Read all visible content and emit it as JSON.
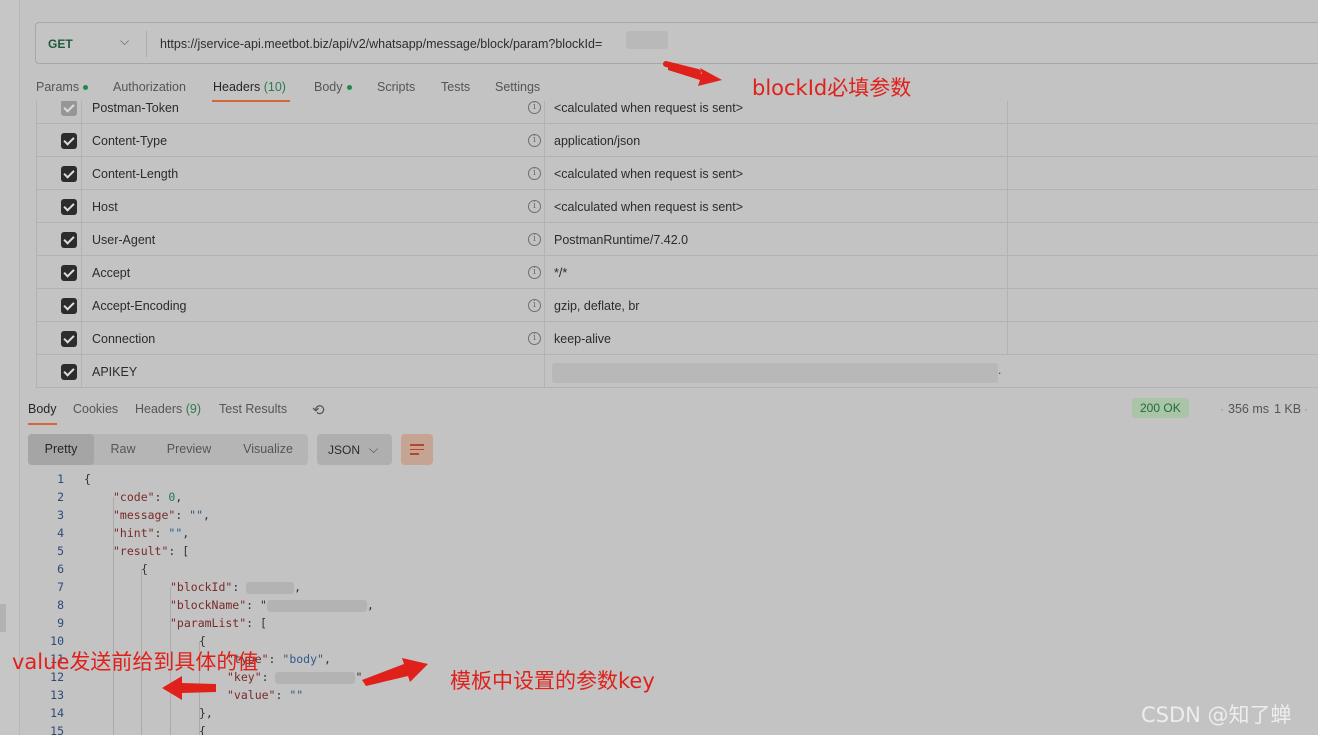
{
  "request": {
    "method": "GET",
    "url": "https://jservice-api.meetbot.biz/api/v2/whatsapp/message/block/param?blockId="
  },
  "request_tabs": [
    {
      "label": "Params",
      "dot": true
    },
    {
      "label": "Authorization"
    },
    {
      "label": "Headers",
      "count": "(10)",
      "active": true
    },
    {
      "label": "Body",
      "dot": true
    },
    {
      "label": "Scripts"
    },
    {
      "label": "Tests"
    },
    {
      "label": "Settings"
    }
  ],
  "headers": [
    {
      "key": "Postman-Token",
      "value": "<calculated when request is sent>",
      "dim": true
    },
    {
      "key": "Content-Type",
      "value": "application/json"
    },
    {
      "key": "Content-Length",
      "value": "<calculated when request is sent>"
    },
    {
      "key": "Host",
      "value": "<calculated when request is sent>"
    },
    {
      "key": "User-Agent",
      "value": "PostmanRuntime/7.42.0"
    },
    {
      "key": "Accept",
      "value": "*/*"
    },
    {
      "key": "Accept-Encoding",
      "value": "gzip, deflate, br"
    },
    {
      "key": "Connection",
      "value": "keep-alive"
    },
    {
      "key": "APIKEY",
      "value": ".",
      "blurred": true
    }
  ],
  "response_tabs": [
    {
      "label": "Body",
      "active": true
    },
    {
      "label": "Cookies"
    },
    {
      "label": "Headers",
      "count": "(9)"
    },
    {
      "label": "Test Results"
    }
  ],
  "response_meta": {
    "status": "200 OK",
    "time": "356 ms",
    "size": "1 KB",
    "separator": "·"
  },
  "view_modes": [
    "Pretty",
    "Raw",
    "Preview",
    "Visualize"
  ],
  "format": "JSON",
  "code_lines": [
    {
      "n": "1",
      "text": "{"
    },
    {
      "n": "2",
      "key": "\"code\"",
      "sep": ": ",
      "num": "0",
      "end": ","
    },
    {
      "n": "3",
      "key": "\"message\"",
      "sep": ": ",
      "str": "\"\"",
      "end": ","
    },
    {
      "n": "4",
      "key": "\"hint\"",
      "sep": ": ",
      "str": "\"\"",
      "end": ","
    },
    {
      "n": "5",
      "key": "\"result\"",
      "sep": ": ",
      "end": "["
    },
    {
      "n": "6",
      "text": "{"
    },
    {
      "n": "7",
      "key": "\"blockId\"",
      "sep": ": ",
      "blur": true,
      "end": ","
    },
    {
      "n": "8",
      "key": "\"blockName\"",
      "sep": ": \"",
      "blur": true,
      "end": ","
    },
    {
      "n": "9",
      "key": "\"paramList\"",
      "sep": ": ",
      "end": "["
    },
    {
      "n": "10",
      "text": "{"
    },
    {
      "n": "11",
      "key": "\"type\"",
      "sep": ": ",
      "str": "\"body\"",
      "end": ","
    },
    {
      "n": "12",
      "key": "\"key\"",
      "sep": ": ",
      "blur": true,
      "end": "\","
    },
    {
      "n": "13",
      "key": "\"value\"",
      "sep": ": ",
      "str": "\"\""
    },
    {
      "n": "14",
      "text": "},"
    },
    {
      "n": "15",
      "text": "{"
    }
  ],
  "annotations": {
    "block_id": "blockId必填参数",
    "param_key": "模板中设置的参数key",
    "value_note": "value发送前给到具体的值"
  },
  "watermark": "CSDN @知了蝉",
  "colors": {
    "accent": "#d4663a",
    "annotation": "#e0201a",
    "status_ok": "#1f6b3a"
  }
}
